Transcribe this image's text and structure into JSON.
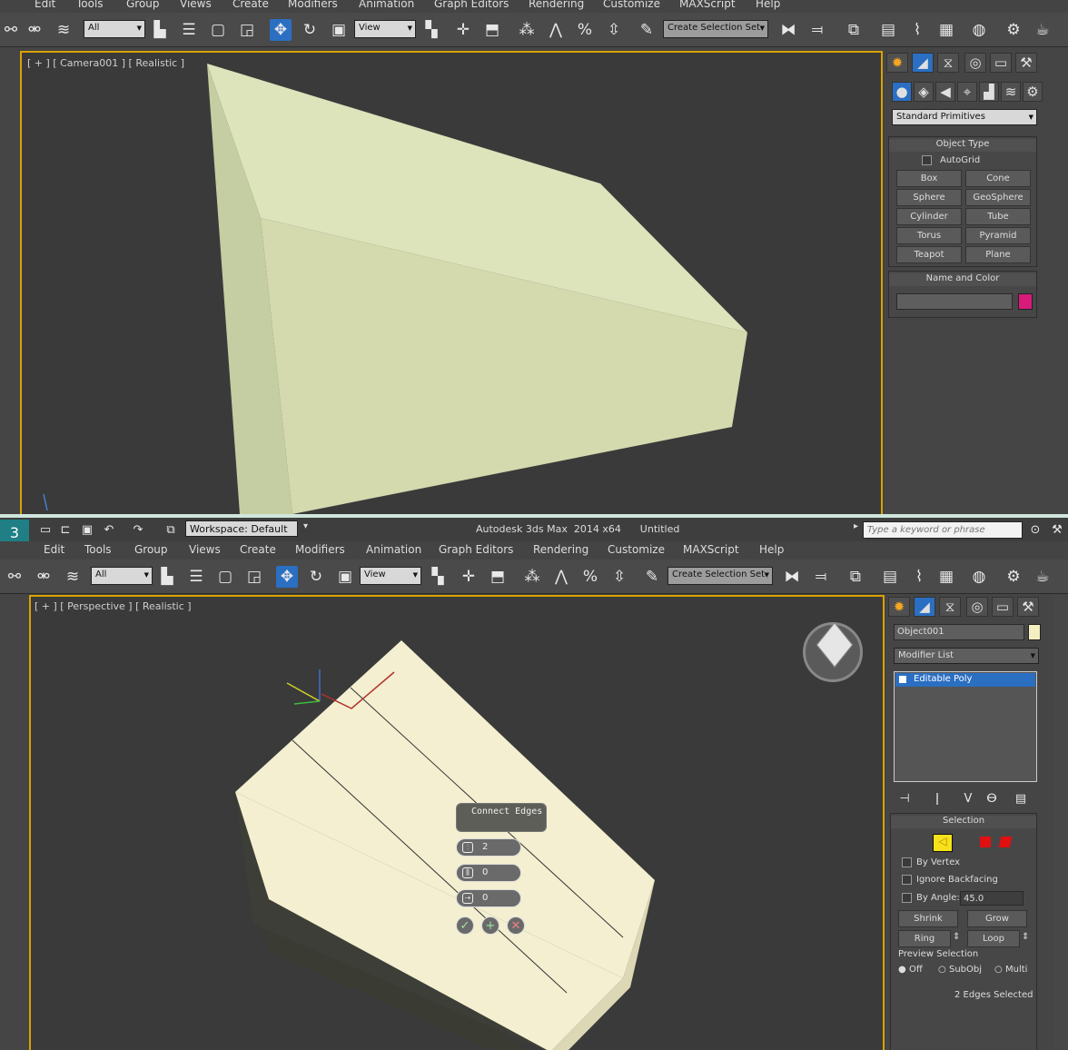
{
  "top": {
    "menu": [
      "Edit",
      "Tools",
      "Group",
      "Views",
      "Create",
      "Modifiers",
      "Animation",
      "Graph Editors",
      "Rendering",
      "Customize",
      "MAXScript",
      "Help"
    ],
    "selection_filter": "All",
    "ref_coord": "View",
    "named_selection": "Create Selection Set",
    "viewport_label": "[ + ] [ Camera001 ] [ Realistic ]",
    "category_dropdown": "Standard Primitives",
    "object_type": {
      "title": "Object Type",
      "autogrid_label": "AutoGrid",
      "buttons": [
        "Box",
        "Cone",
        "Sphere",
        "GeoSphere",
        "Cylinder",
        "Tube",
        "Torus",
        "Pyramid",
        "Teapot",
        "Plane"
      ]
    },
    "name_and_color": {
      "title": "Name and Color",
      "name_value": "",
      "color": "#d81b7a"
    }
  },
  "bottom": {
    "quick_access": {
      "workspace": "Workspace: Default"
    },
    "title": "Autodesk 3ds Max  2014 x64      Untitled",
    "search_placeholder": "Type a keyword or phrase",
    "menu": [
      "Edit",
      "Tools",
      "Group",
      "Views",
      "Create",
      "Modifiers",
      "Animation",
      "Graph Editors",
      "Rendering",
      "Customize",
      "MAXScript",
      "Help"
    ],
    "selection_filter": "All",
    "ref_coord": "View",
    "named_selection": "Create Selection Set",
    "viewport_label": "[ + ] [ Perspective ] [ Realistic ]",
    "caddy": {
      "title": "Connect Edges",
      "segments": "2",
      "pinch": "0",
      "slide": "0"
    },
    "object_name": "Object001",
    "object_color": "#f3efc0",
    "modifier_list": "Modifier List",
    "modifier_stack": [
      "Editable Poly"
    ],
    "selection": {
      "title": "Selection",
      "by_vertex": "By Vertex",
      "ignore_backfacing": "Ignore Backfacing",
      "by_angle": "By Angle:",
      "by_angle_value": "45.0",
      "shrink": "Shrink",
      "grow": "Grow",
      "ring": "Ring",
      "loop": "Loop",
      "preview_label": "Preview Selection",
      "preview_options": [
        "Off",
        "SubObj",
        "Multi"
      ],
      "status": "2 Edges Selected"
    }
  }
}
